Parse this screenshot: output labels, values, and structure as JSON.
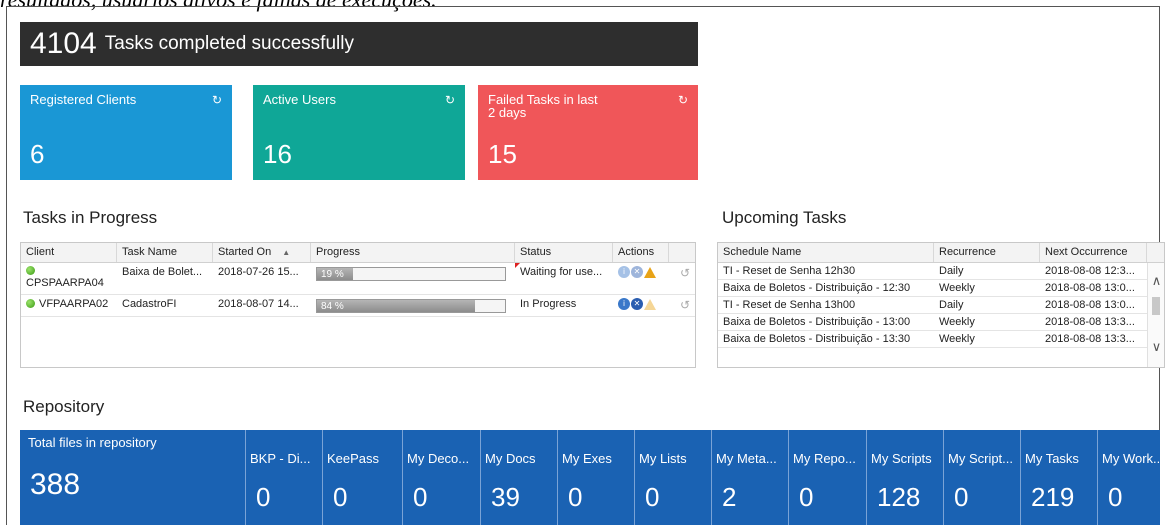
{
  "caption": "resultados, usuários ativos e falhas de execuções.",
  "banner": {
    "count": "4104",
    "text": "Tasks completed successfully"
  },
  "tiles": [
    {
      "label": "Registered Clients",
      "value": "6",
      "color": "#1a97d5"
    },
    {
      "label": "Active Users",
      "value": "16",
      "color": "#0fa797"
    },
    {
      "label": "Failed Tasks in last 2 days",
      "value": "15",
      "color": "#f05659"
    }
  ],
  "tasks_in_progress": {
    "title": "Tasks in Progress",
    "columns": [
      "Client",
      "Task Name",
      "Started On",
      "Progress",
      "Status",
      "Actions"
    ],
    "rows": [
      {
        "client": "CPSPAARPA04",
        "task": "Baixa de Bolet...",
        "started": "2018-07-26 15...",
        "progress": 19,
        "progress_label": "19 %",
        "status": "Waiting for use..."
      },
      {
        "client": "VFPAARPA02",
        "task": "CadastroFI",
        "started": "2018-08-07 14...",
        "progress": 84,
        "progress_label": "84 %",
        "status": "In Progress"
      }
    ]
  },
  "upcoming_tasks": {
    "title": "Upcoming Tasks",
    "columns": [
      "Schedule Name",
      "Recurrence",
      "Next Occurrence"
    ],
    "rows": [
      {
        "name": "TI - Reset de Senha 12h30",
        "recurrence": "Daily",
        "next": "2018-08-08 12:3..."
      },
      {
        "name": "Baixa de Boletos - Distribuição - 12:30",
        "recurrence": "Weekly",
        "next": "2018-08-08 13:0..."
      },
      {
        "name": "TI - Reset de Senha 13h00",
        "recurrence": "Daily",
        "next": "2018-08-08 13:0..."
      },
      {
        "name": "Baixa de Boletos - Distribuição - 13:00",
        "recurrence": "Weekly",
        "next": "2018-08-08 13:3..."
      },
      {
        "name": "Baixa de Boletos - Distribuição - 13:30",
        "recurrence": "Weekly",
        "next": "2018-08-08 13:3..."
      }
    ]
  },
  "repository": {
    "title": "Repository",
    "total_label": "Total files in repository",
    "total_value": "388",
    "folders": [
      {
        "label": "BKP - Di...",
        "value": "0"
      },
      {
        "label": "KeePass",
        "value": "0"
      },
      {
        "label": "My Deco...",
        "value": "0"
      },
      {
        "label": "My Docs",
        "value": "39"
      },
      {
        "label": "My Exes",
        "value": "0"
      },
      {
        "label": "My Lists",
        "value": "0"
      },
      {
        "label": "My Meta...",
        "value": "2"
      },
      {
        "label": "My Repo...",
        "value": "0"
      },
      {
        "label": "My Scripts",
        "value": "128"
      },
      {
        "label": "My Script...",
        "value": "0"
      },
      {
        "label": "My Tasks",
        "value": "219"
      },
      {
        "label": "My Work...",
        "value": "0"
      }
    ]
  }
}
